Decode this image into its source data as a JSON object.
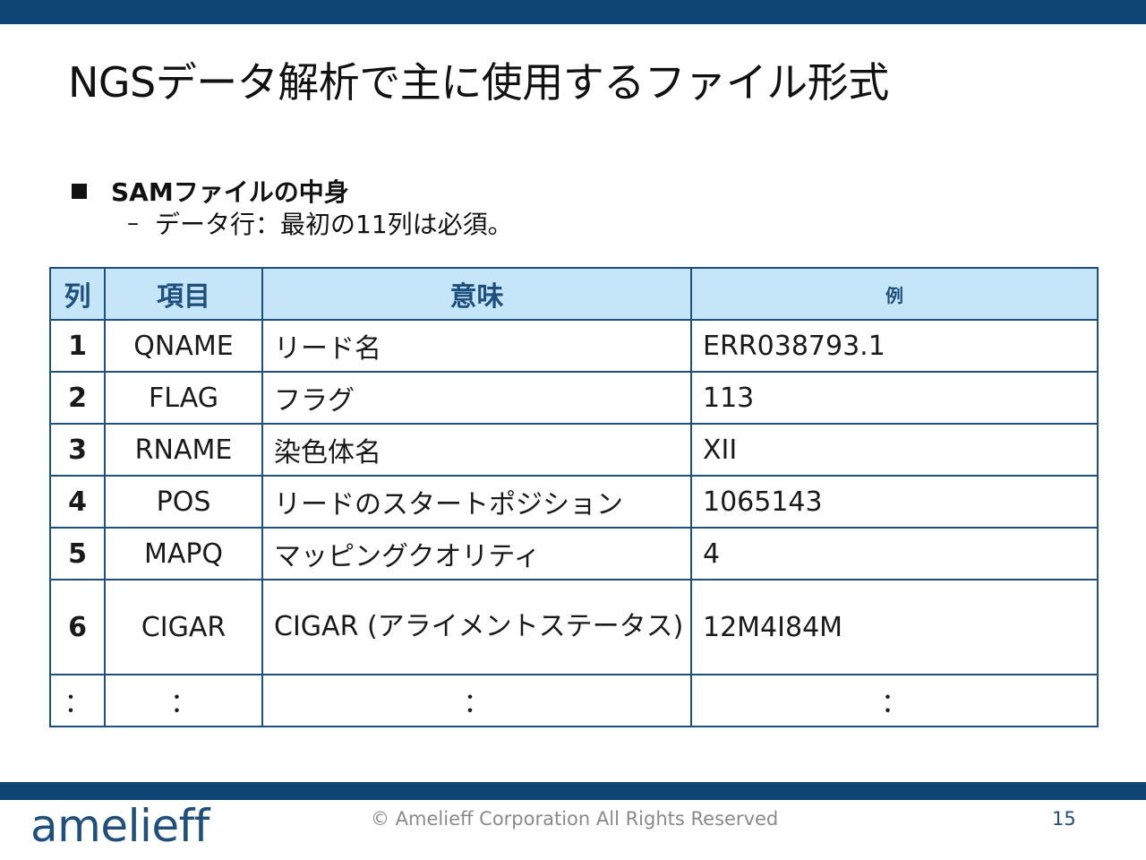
{
  "title": "NGSデータ解析で主に使用するファイル形式",
  "bullet": "SAMファイルの中身",
  "sub_dash": "–",
  "sub_bullet": "データ行：最初の11列は必須。",
  "table": {
    "headers": [
      "列",
      "項目",
      "意味",
      "例"
    ],
    "rows": [
      {
        "num": "1",
        "field": "QNAME",
        "meaning": "リード名",
        "example": "ERR038793.1"
      },
      {
        "num": "2",
        "field": "FLAG",
        "meaning": "フラグ",
        "example": "113"
      },
      {
        "num": "3",
        "field": "RNAME",
        "meaning": "染色体名",
        "example": "XII"
      },
      {
        "num": "4",
        "field": "POS",
        "meaning": "リードのスタートポジション",
        "example": "1065143"
      },
      {
        "num": "5",
        "field": "MAPQ",
        "meaning": "マッピングクオリティ",
        "example": "4"
      },
      {
        "num": "6",
        "field": "CIGAR",
        "meaning": "CIGAR\n(アライメントステータス)",
        "example": "12M4I84M"
      },
      {
        "num": "：",
        "field": "：",
        "meaning": "：",
        "example": "："
      }
    ]
  },
  "footer": {
    "logo": "amelieff",
    "copyright": "© Amelieff Corporation All Rights Reserved",
    "page": "15"
  },
  "colors": {
    "bar": "#0f4574",
    "header_bg": "#c5e6f9",
    "border": "#1e4f7d",
    "logo": "#1e4f7d"
  }
}
